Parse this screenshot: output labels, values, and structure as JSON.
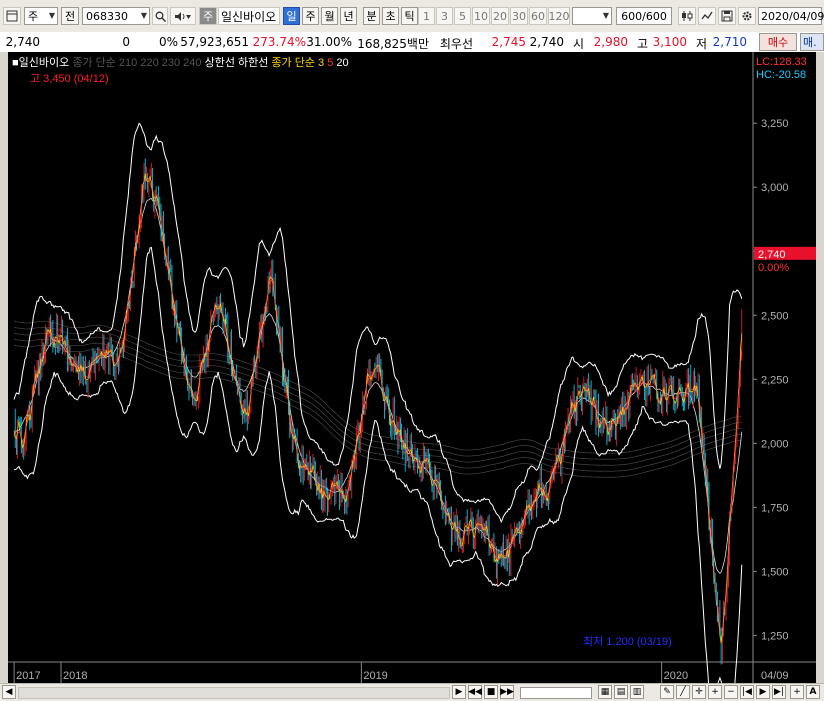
{
  "toolbar": {
    "market_label": "주",
    "prev_label": "전",
    "stock_code": "068330",
    "stock_name": "일신바이오",
    "period_buttons": [
      "일",
      "주",
      "월",
      "년",
      "분",
      "초",
      "틱"
    ],
    "active_period": "일",
    "interval_buttons": [
      "1",
      "3",
      "5",
      "10",
      "20",
      "30",
      "60",
      "120"
    ],
    "count_value": "600",
    "count_total": "/600",
    "date_value": "2020/04/09"
  },
  "infobar": {
    "price": "2,740",
    "change": "0",
    "change_pct": "0%",
    "volume": "57,923,651",
    "volume_ratio": "273.74%",
    "turnover": "31.00%",
    "amount": "168,825백만",
    "best_label": "최우선",
    "best_ask": "2,745",
    "best_bid": "2,740",
    "open_label": "시",
    "open": "2,980",
    "high_label": "고",
    "high": "3,100",
    "low_label": "저",
    "low": "2,710",
    "buy_button": "매수",
    "sell_button": "매."
  },
  "colors": {
    "background": "#000000",
    "up": "#ff2020",
    "down": "#00d8ff",
    "price_badge": "#e8102a",
    "envelope": "#ffffff",
    "annotation_high": "#ff2020",
    "annotation_low": "#2030ff"
  },
  "chart_data": {
    "type": "line",
    "title": "일신바이오",
    "legend": [
      {
        "text": "종가 단순",
        "color": "#555555"
      },
      {
        "text": "210",
        "color": "#555555"
      },
      {
        "text": "220",
        "color": "#555555"
      },
      {
        "text": "230",
        "color": "#555555"
      },
      {
        "text": "240",
        "color": "#555555"
      },
      {
        "text": "상한선",
        "color": "#ffffff"
      },
      {
        "text": "하한선",
        "color": "#ffffff"
      },
      {
        "text": "종가 단순 3",
        "color": "#ffd700"
      },
      {
        "text": "5",
        "color": "#ff3030"
      },
      {
        "text": "20",
        "color": "#ffffff"
      }
    ],
    "ylim": [
      1150,
      3450
    ],
    "yticks": [
      1250,
      1500,
      1750,
      2000,
      2250,
      2500,
      2750,
      3000,
      3250
    ],
    "ytick_labels": [
      "1,250",
      "1,500",
      "1,750",
      "2,000",
      "2,250",
      "2,500",
      "2,750",
      "3,000",
      "3,250"
    ],
    "x_period": [
      "2017-11",
      "2020-04"
    ],
    "xtick_labels": [
      "2017",
      "2018",
      "2019",
      "2020",
      "04/09"
    ],
    "xtick_positions": [
      "2017-11-06",
      "2018-01-02",
      "2019-01-02",
      "2020-01-02",
      "2020-04-09"
    ],
    "series": [
      {
        "name": "종가",
        "x": [
          "2017-11",
          "2017-12",
          "2018-01",
          "2018-02",
          "2018-03",
          "2018-04",
          "2018-05",
          "2018-06",
          "2018-07",
          "2018-08",
          "2018-09",
          "2018-10",
          "2018-11",
          "2018-12",
          "2019-01",
          "2019-02",
          "2019-03",
          "2019-04",
          "2019-05",
          "2019-06",
          "2019-07",
          "2019-08",
          "2019-09",
          "2019-10",
          "2019-11",
          "2019-12",
          "2020-01",
          "2020-02",
          "2020-03",
          "2020-04"
        ],
        "values": [
          2050,
          2400,
          2350,
          2280,
          2320,
          3100,
          2600,
          2200,
          2500,
          2150,
          2600,
          2000,
          1750,
          1850,
          2250,
          2100,
          1900,
          1750,
          1650,
          1550,
          1700,
          1800,
          2150,
          2100,
          2150,
          2200,
          2250,
          2150,
          1250,
          2740
        ]
      }
    ],
    "current_price": "2,740",
    "current_change": "0.00%",
    "lc_label": "LC:128.33",
    "hc_label": "HC:-20.58",
    "high_annotation": "고 3,450 (04/12)",
    "low_annotation": "최저 1,200 (03/19)"
  }
}
